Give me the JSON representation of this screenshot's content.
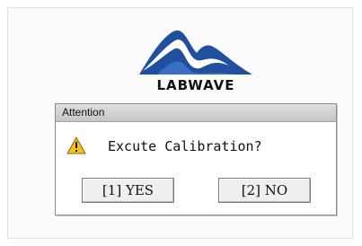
{
  "brand": {
    "logo_text": "LABWAVE",
    "colors": {
      "mountain_primary": "#1f4f9e",
      "mountain_highlight": "#3a6fc4",
      "text": "#111111"
    }
  },
  "dialog": {
    "title": "Attention",
    "icon": "warning-icon",
    "message": "Excute Calibration?",
    "buttons": {
      "yes_label": "[1] YES",
      "no_label": "[2] NO"
    }
  }
}
